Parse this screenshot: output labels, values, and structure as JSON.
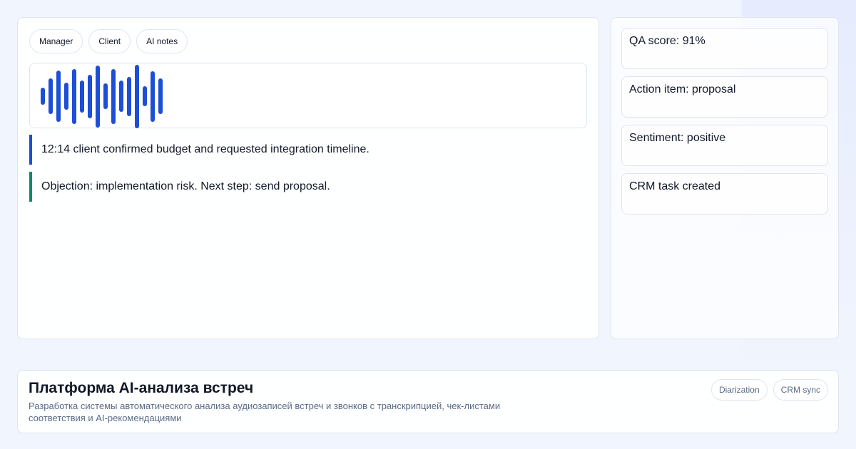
{
  "speaker_tabs": [
    "Manager",
    "Client",
    "AI notes"
  ],
  "waveform": {
    "levels": [
      0.27,
      0.55,
      0.8,
      0.42,
      0.85,
      0.5,
      0.68,
      0.97,
      0.4,
      0.85,
      0.49,
      0.61,
      0.99,
      0.31,
      0.79,
      0.55
    ],
    "color": "#1d4ed8"
  },
  "transcript": {
    "line_1": "12:14 client confirmed budget and requested integration timeline.",
    "line_2": "Objection: implementation risk. Next step: send proposal."
  },
  "accents": {
    "primary": "#1d4ed8",
    "success": "#0f8a6a"
  },
  "insights": [
    "QA score: 91%",
    "Action item: proposal",
    "Sentiment: positive",
    "CRM task created"
  ],
  "project": {
    "title": "Платформа AI-анализа встреч",
    "description": "Разработка системы автоматического анализа аудиозаписей встреч и звонков с транскрипцией, чек-листами соответствия и AI-рекомендациями",
    "tags": [
      "Diarization",
      "CRM sync"
    ]
  }
}
